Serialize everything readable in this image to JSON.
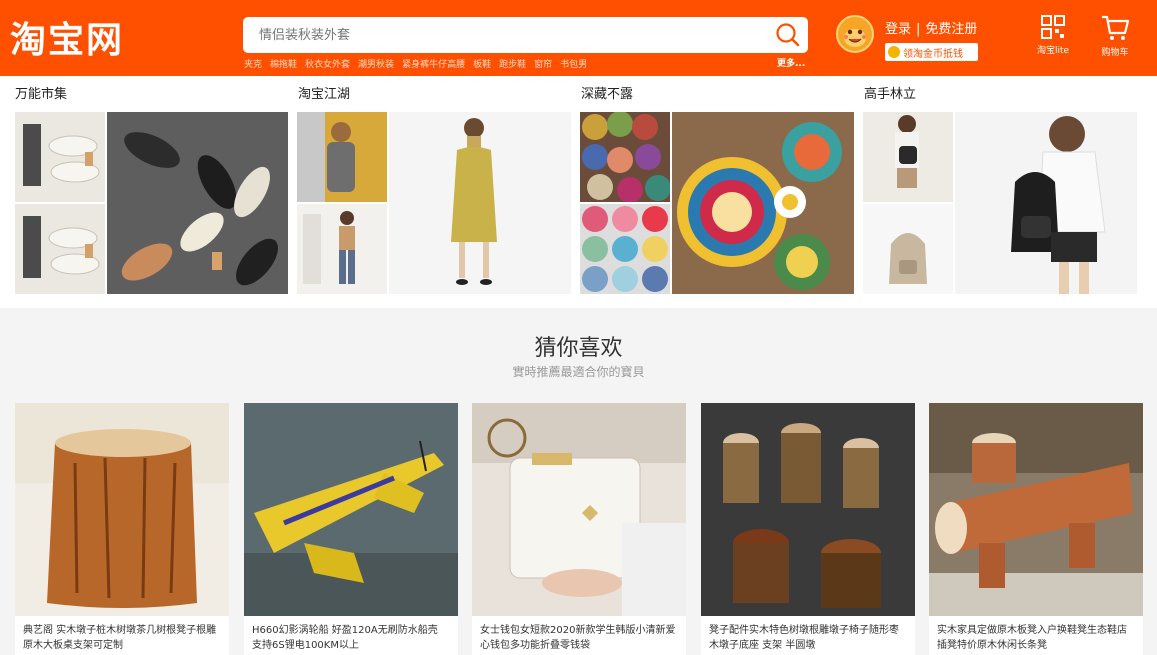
{
  "header": {
    "logo_text": "淘宝网",
    "search": {
      "placeholder": "情侣装秋装外套",
      "hot_words": [
        "夹克",
        "棉拖鞋",
        "秋衣女外套",
        "潮男秋装",
        "紧身裤牛仔高腰",
        "板鞋",
        "跑步鞋",
        "窗帘",
        "书包男"
      ],
      "more": "更多..."
    },
    "user": {
      "login": "登录",
      "separator": "|",
      "register": "免费注册",
      "coin": "领淘金币抵钱"
    },
    "tools": [
      {
        "label": "淘宝lite",
        "icon": "qr-code-icon"
      },
      {
        "label": "购物车",
        "icon": "shopping-cart-icon"
      }
    ]
  },
  "market": {
    "columns": [
      {
        "title": "万能市集"
      },
      {
        "title": "淘宝江湖"
      },
      {
        "title": "深藏不露"
      },
      {
        "title": "高手林立"
      }
    ]
  },
  "guess": {
    "title": "猜你喜欢",
    "subtitle": "實時推薦最適合你的寶貝",
    "items": [
      {
        "title": "典艺阁 实木墩子桩木树墩茶几树根凳子根雕原木大板桌支架可定制"
      },
      {
        "title": "H660幻影涡轮船 好盈120A无刷防水船壳 支持6S锂电100KM以上"
      },
      {
        "title": "女士钱包女短款2020新款学生韩版小清新爱心钱包多功能折叠零钱袋"
      },
      {
        "title": "凳子配件实木特色树墩根雕墩子椅子随形枣木墩子底座 支架 半圆墩"
      },
      {
        "title": "实木家具定做原木板凳入户换鞋凳生态鞋店插凳特价原木休闲长条凳"
      }
    ]
  },
  "colors": {
    "brand": "#ff5000",
    "page_bg": "#f4f4f4"
  }
}
